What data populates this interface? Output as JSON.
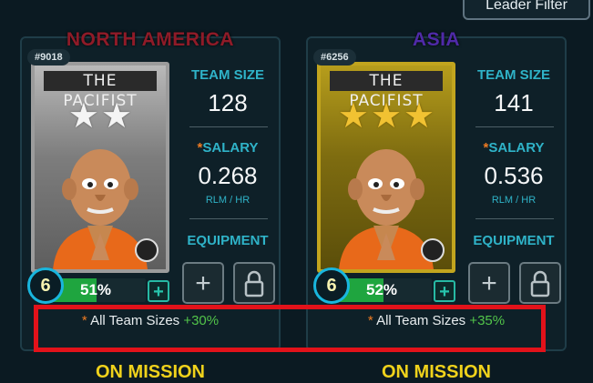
{
  "leader_filter_label": "Leader Filter",
  "cards": [
    {
      "region": "NORTH AMERICA",
      "id": "#9018",
      "card_title": "THE PACIFIST",
      "stars": 2,
      "level": "6",
      "progress_text": "51%",
      "progress_value": 0.51,
      "team_size_label": "TEAM SIZE",
      "team_size": "128",
      "salary_label": "SALARY",
      "salary": "0.268",
      "salary_unit": "RLM / HR",
      "equipment_label": "EQUIPMENT",
      "bonus_text": "All Team Sizes",
      "bonus_value": "+30%",
      "status": "ON MISSION",
      "tier_color": "#9c9c9c"
    },
    {
      "region": "ASIA",
      "id": "#6256",
      "card_title": "THE PACIFIST",
      "stars": 3,
      "level": "6",
      "progress_text": "52%",
      "progress_value": 0.52,
      "team_size_label": "TEAM SIZE",
      "team_size": "141",
      "salary_label": "SALARY",
      "salary": "0.536",
      "salary_unit": "RLM / HR",
      "equipment_label": "EQUIPMENT",
      "bonus_text": "All Team Sizes",
      "bonus_value": "+35%",
      "status": "ON MISSION",
      "tier_color": "#c2a51e"
    }
  ],
  "icons": {
    "equipment_add": "plus-icon",
    "equipment_locked": "lock-icon",
    "level_up": "plus-icon",
    "star": "star-icon"
  }
}
